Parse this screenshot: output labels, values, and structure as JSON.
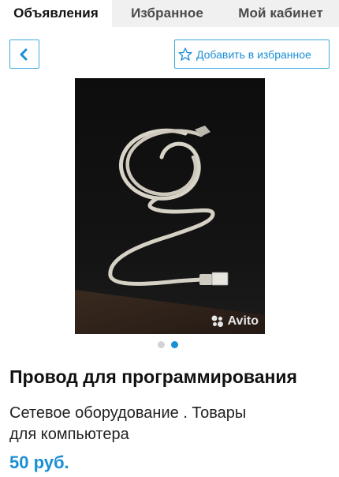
{
  "tabs": [
    {
      "label": "Объявления",
      "active": true
    },
    {
      "label": "Избранное",
      "active": false
    },
    {
      "label": "Мой кабинет",
      "active": false
    }
  ],
  "toolbar": {
    "back_icon": "chevron-left-icon",
    "favorite_icon": "star-outline-icon",
    "favorite_label": "Добавить в избранное"
  },
  "gallery": {
    "watermark": "Avito",
    "image_count": 2,
    "current_index": 2
  },
  "listing": {
    "title": "Провод для программирования",
    "category_line1": "Сетевое оборудование . Товары",
    "category_line2": "для компьютера",
    "price": "50 руб."
  },
  "colors": {
    "accent": "#1a8fd6",
    "border": "#3fa9e0",
    "tab_bar": "#f0f0f0"
  }
}
